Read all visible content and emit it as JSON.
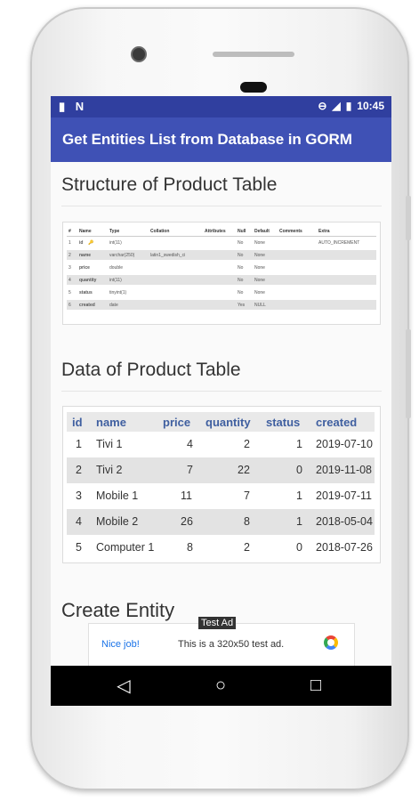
{
  "statusbar": {
    "left_icons": [
      "sd-card-icon",
      "notification-n-icon"
    ],
    "left_glyphs": [
      "▮",
      "N"
    ],
    "right_glyphs": [
      "⊖",
      "◢",
      "▮"
    ],
    "time": "10:45"
  },
  "appbar": {
    "title": "Get Entities List from Database in GORM"
  },
  "structure_section": {
    "title": "Structure of Product Table",
    "headers": [
      "#",
      "Name",
      "Type",
      "Collation",
      "Attributes",
      "Null",
      "Default",
      "Comments",
      "Extra"
    ],
    "rows": [
      [
        "1",
        "id",
        "int(11)",
        "",
        "",
        "No",
        "None",
        "",
        "AUTO_INCREMENT"
      ],
      [
        "2",
        "name",
        "varchar(250)",
        "latin1_swedish_ci",
        "",
        "No",
        "None",
        "",
        ""
      ],
      [
        "3",
        "price",
        "double",
        "",
        "",
        "No",
        "None",
        "",
        ""
      ],
      [
        "4",
        "quantity",
        "int(11)",
        "",
        "",
        "No",
        "None",
        "",
        ""
      ],
      [
        "5",
        "status",
        "tinyint(1)",
        "",
        "",
        "No",
        "None",
        "",
        ""
      ],
      [
        "6",
        "created",
        "date",
        "",
        "",
        "Yes",
        "NULL",
        "",
        ""
      ]
    ]
  },
  "data_section": {
    "title": "Data of Product Table",
    "headers": [
      "id",
      "name",
      "price",
      "quantity",
      "status",
      "created"
    ],
    "rows": [
      [
        "1",
        "Tivi 1",
        "4",
        "2",
        "1",
        "2019-07-10"
      ],
      [
        "2",
        "Tivi 2",
        "7",
        "22",
        "0",
        "2019-11-08"
      ],
      [
        "3",
        "Mobile 1",
        "11",
        "7",
        "1",
        "2019-07-11"
      ],
      [
        "4",
        "Mobile 2",
        "26",
        "8",
        "1",
        "2018-05-04"
      ],
      [
        "5",
        "Computer 1",
        "8",
        "2",
        "0",
        "2018-07-26"
      ]
    ]
  },
  "create_section": {
    "title": "Create Entity"
  },
  "ad": {
    "tag": "Test Ad",
    "left_text": "Nice job!",
    "body": "This is a 320x50 test ad."
  },
  "navbar": {
    "back": "◁",
    "home": "○",
    "recents": "□"
  }
}
